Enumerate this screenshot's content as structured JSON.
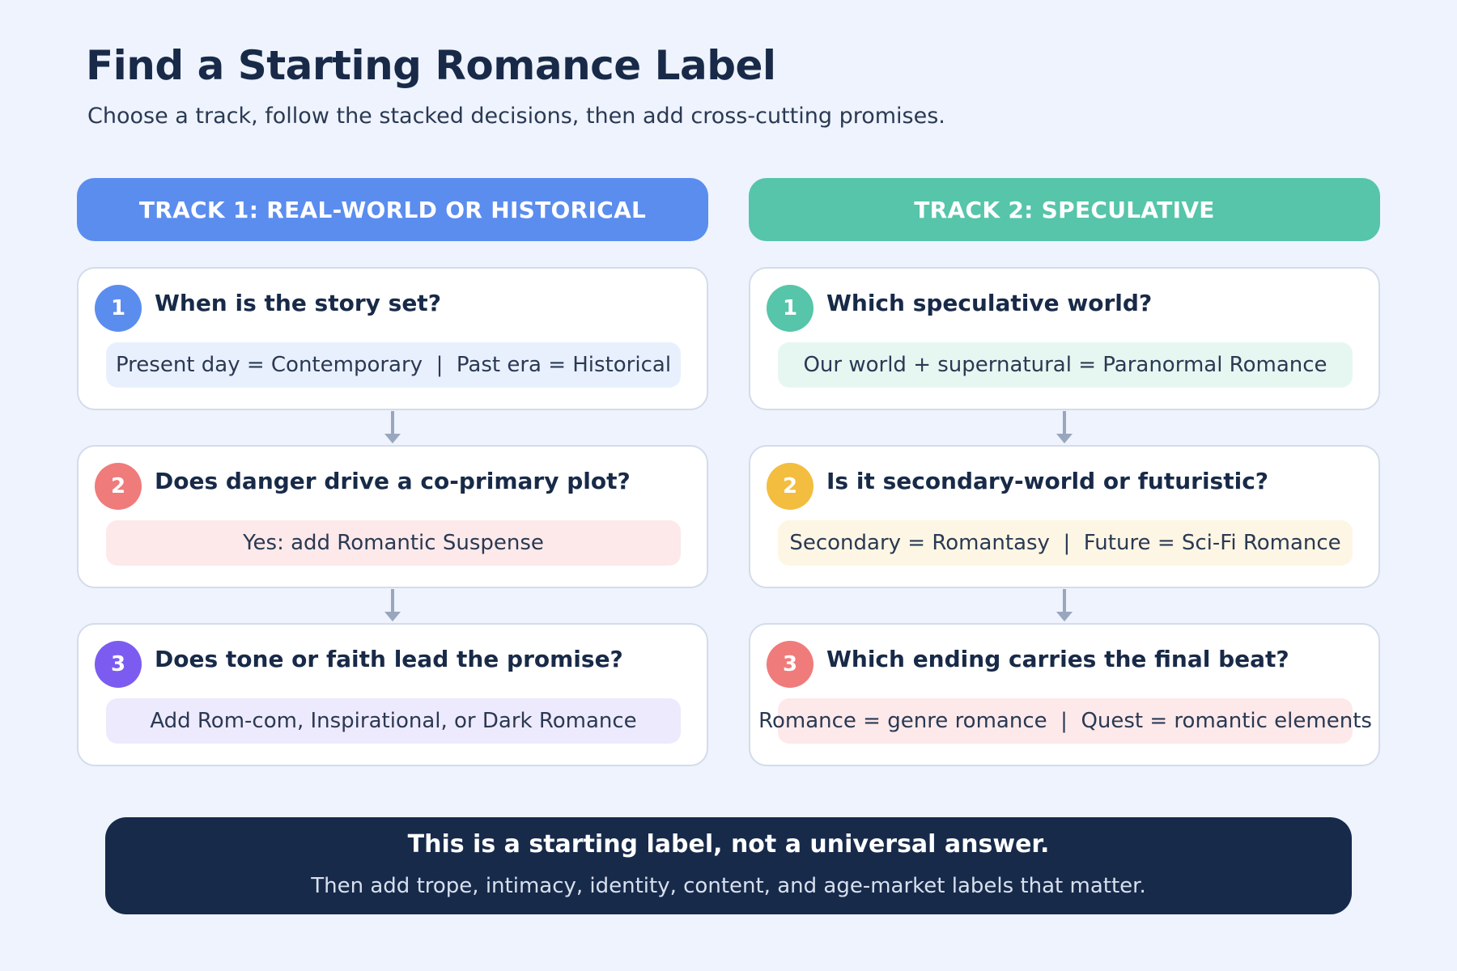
{
  "title": "Find a Starting Romance Label",
  "subtitle": "Choose a track, follow the stacked decisions, then add cross-cutting promises.",
  "tracks": [
    {
      "label": "TRACK 1: REAL-WORLD OR HISTORICAL",
      "color": "#5b8def",
      "steps": [
        {
          "number": "1",
          "question": "When is the story set?",
          "answer": "Present day = Contemporary  |  Past era = Historical",
          "badge_color": "#5b8def",
          "answer_bg": "#e9f0fd"
        },
        {
          "number": "2",
          "question": "Does danger drive a co-primary plot?",
          "answer": "Yes: add Romantic Suspense",
          "badge_color": "#f07b7b",
          "answer_bg": "#fde9ea"
        },
        {
          "number": "3",
          "question": "Does tone or faith lead the promise?",
          "answer": "Add Rom-com, Inspirational, or Dark Romance",
          "badge_color": "#7c5cf0",
          "answer_bg": "#eeeafd"
        }
      ]
    },
    {
      "label": "TRACK 2: SPECULATIVE",
      "color": "#56c5aa",
      "steps": [
        {
          "number": "1",
          "question": "Which speculative world?",
          "answer": "Our world + supernatural = Paranormal Romance",
          "badge_color": "#56c5aa",
          "answer_bg": "#e6f7f1"
        },
        {
          "number": "2",
          "question": "Is it secondary-world or futuristic?",
          "answer": "Secondary = Romantasy  |  Future = Sci-Fi Romance",
          "badge_color": "#f3bd3f",
          "answer_bg": "#fdf6e4"
        },
        {
          "number": "3",
          "question": "Which ending carries the final beat?",
          "answer": "Romance = genre romance  |  Quest = romantic elements",
          "badge_color": "#f07b7b",
          "answer_bg": "#fde9ea"
        }
      ]
    }
  ],
  "footer": {
    "title": "This is a starting label, not a universal answer.",
    "text": "Then add trope, intimacy, identity, content, and age-market labels that matter."
  }
}
